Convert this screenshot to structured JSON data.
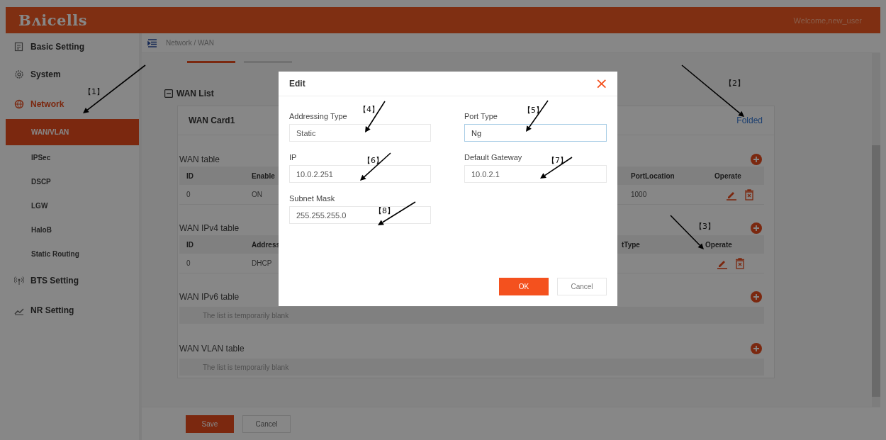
{
  "header": {
    "logo": "Bʌicells",
    "welcome": "Welcome,new_user"
  },
  "sidebar": {
    "items": [
      {
        "label": "Basic Setting",
        "selected": false
      },
      {
        "label": "System",
        "selected": false
      },
      {
        "label": "Network",
        "selected": true,
        "children": [
          {
            "label": "WAN/VLAN",
            "selected": true
          },
          {
            "label": "IPSec",
            "selected": false
          },
          {
            "label": "DSCP",
            "selected": false
          },
          {
            "label": "LGW",
            "selected": false
          },
          {
            "label": "HaloB",
            "selected": false
          },
          {
            "label": "Static Routing",
            "selected": false
          }
        ]
      },
      {
        "label": "BTS Setting",
        "selected": false
      },
      {
        "label": "NR Setting",
        "selected": false
      }
    ]
  },
  "breadcrumb": "Network / WAN",
  "tabs": [
    {
      "selected": true
    },
    {
      "selected": false
    }
  ],
  "section_title": "WAN List",
  "card": {
    "title": "WAN Card1",
    "fold_link": "Folded",
    "tables": [
      {
        "title": "WAN table",
        "columns": [
          {
            "label": "ID",
            "kind": "text"
          },
          {
            "label": "Enable",
            "kind": "text"
          },
          {
            "label": "PortLocation",
            "kind": "text"
          },
          {
            "label": "Operate",
            "kind": "operate"
          }
        ],
        "rows": [
          [
            "0",
            "ON",
            "1000",
            null
          ]
        ]
      },
      {
        "title": "WAN IPv4 table",
        "columns": [
          {
            "label": "ID",
            "kind": "text"
          },
          {
            "label": "Address",
            "kind": "text"
          },
          {
            "label": "tType",
            "kind": "text"
          },
          {
            "label": "Operate",
            "kind": "operate"
          }
        ],
        "rows": [
          [
            "0",
            "DHCP",
            null,
            null
          ]
        ]
      },
      {
        "title": "WAN IPv6 table",
        "empty_text": "The list is temporarily blank"
      },
      {
        "title": "WAN VLAN table",
        "empty_text": "The list is temporarily blank"
      }
    ]
  },
  "footer_buttons": [
    {
      "label": "Save",
      "kind": "primary"
    },
    {
      "label": "Cancel",
      "kind": "default"
    }
  ],
  "dialog": {
    "title": "Edit",
    "close": "×",
    "fields": [
      {
        "label": "Addressing Type",
        "value": "Static",
        "focused": false
      },
      {
        "label": "Port Type",
        "value": "Ng",
        "focused": true
      },
      {
        "label": "IP",
        "value": "10.0.2.251",
        "focused": false
      },
      {
        "label": "Default Gateway",
        "value": "10.0.2.1",
        "focused": false
      },
      {
        "label": "Subnet Mask",
        "value": "255.255.255.0",
        "focused": false
      }
    ],
    "buttons": [
      {
        "label": "OK",
        "kind": "primary"
      },
      {
        "label": "Cancel",
        "kind": "default"
      }
    ]
  },
  "annotations": [
    "【1】",
    "【2】",
    "【3】",
    "【4】",
    "【5】",
    "【6】",
    "【7】",
    "【8】"
  ]
}
